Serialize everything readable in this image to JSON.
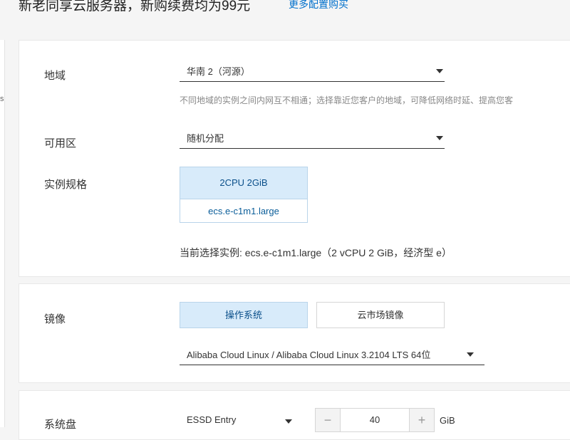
{
  "banner": {
    "text": "新老同享云服务器，新购续费均为99元",
    "link": "更多配置购买"
  },
  "left_mark": "s",
  "region": {
    "label": "地域",
    "value": "华南 2（河源）",
    "hint": "不同地域的实例之间内网互不相通；选择靠近您客户的地域，可降低网络时延、提高您客"
  },
  "zone": {
    "label": "可用区",
    "value": "随机分配"
  },
  "spec": {
    "label": "实例规格",
    "cpu_mem": "2CPU 2GiB",
    "name": "ecs.e-c1m1.large",
    "current": "当前选择实例: ecs.e-c1m1.large（2 vCPU 2 GiB，经济型 e）"
  },
  "image": {
    "label": "镜像",
    "tabs": [
      "操作系统",
      "云市场镜像"
    ],
    "active_tab": 0,
    "os_value": "Alibaba Cloud Linux / Alibaba Cloud Linux 3.2104 LTS 64位"
  },
  "system_disk": {
    "label": "系统盘",
    "type": "ESSD Entry",
    "minus": "−",
    "size": "40",
    "plus": "+",
    "unit": "GiB"
  },
  "colors": {
    "accent_link": "#0070cc",
    "selected_bg": "#d8ebfa",
    "selected_border": "#b9d4ea"
  }
}
